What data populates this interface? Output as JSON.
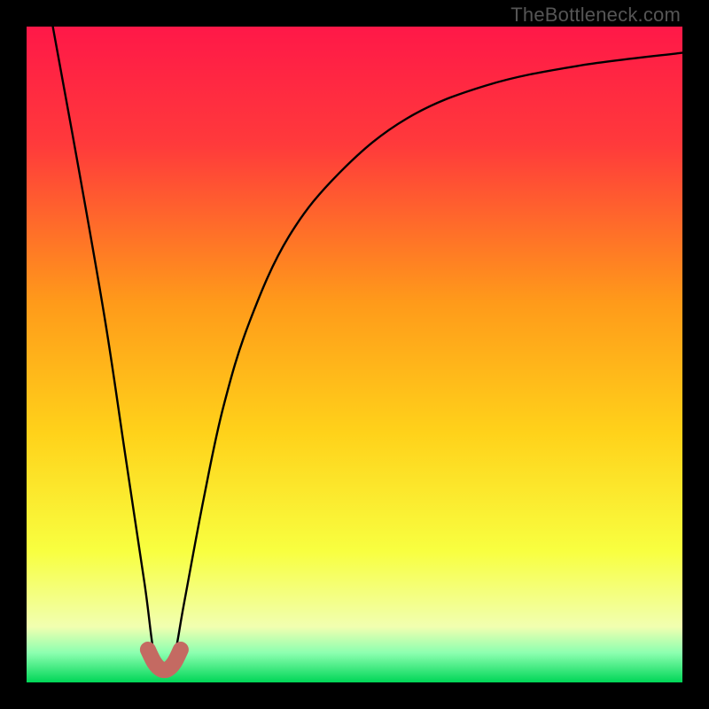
{
  "watermark": "TheBottleneck.com",
  "chart_data": {
    "type": "line",
    "title": "",
    "xlabel": "",
    "ylabel": "",
    "xlim": [
      0,
      100
    ],
    "ylim": [
      0,
      100
    ],
    "series": [
      {
        "name": "bottleneck-curve",
        "x": [
          4,
          8,
          12,
          15,
          18,
          19.5,
          21,
          22.5,
          24,
          27,
          30,
          34,
          40,
          48,
          58,
          70,
          84,
          100
        ],
        "values": [
          100,
          78,
          55,
          35,
          15,
          4,
          2,
          4,
          12,
          28,
          42,
          55,
          68,
          78,
          86,
          91,
          94,
          96
        ]
      },
      {
        "name": "dip-region-marker",
        "x": [
          18.5,
          19.5,
          20.5,
          21.5,
          22.5,
          23.5
        ],
        "values": [
          5,
          3,
          2,
          2,
          3,
          5
        ]
      }
    ],
    "gradient_stops": [
      {
        "pos": 0.0,
        "color": "#ff1848"
      },
      {
        "pos": 0.18,
        "color": "#ff3a3b"
      },
      {
        "pos": 0.42,
        "color": "#ff9a1a"
      },
      {
        "pos": 0.62,
        "color": "#ffd21a"
      },
      {
        "pos": 0.8,
        "color": "#f8ff40"
      },
      {
        "pos": 0.915,
        "color": "#f1ffb0"
      },
      {
        "pos": 0.955,
        "color": "#8cffb0"
      },
      {
        "pos": 1.0,
        "color": "#00d657"
      }
    ],
    "dip_marker_color": "#c46a62"
  }
}
